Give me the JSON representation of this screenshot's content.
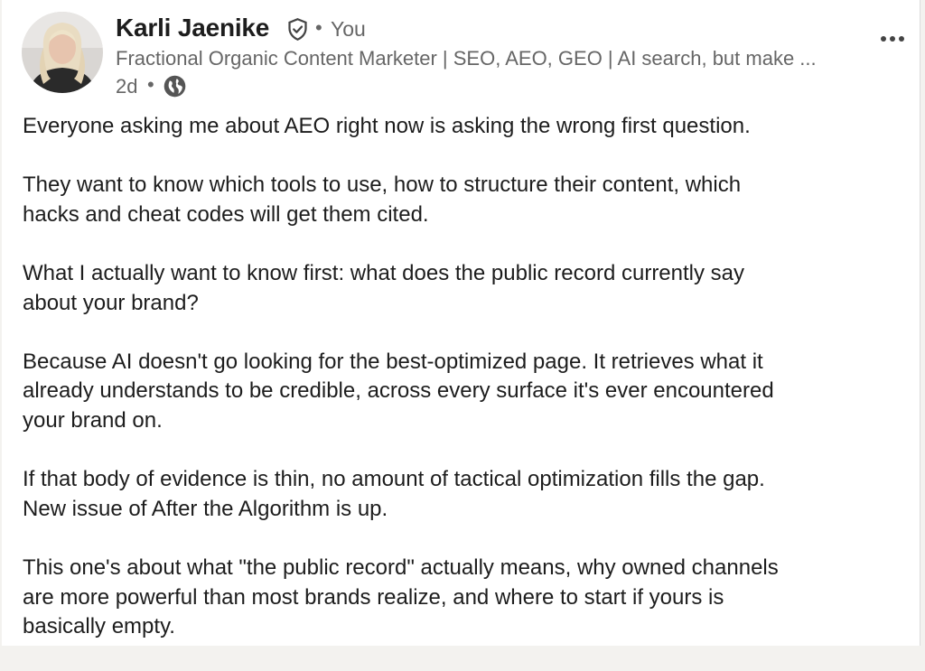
{
  "post": {
    "author": {
      "name": "Karli Jaenike",
      "connection": "You",
      "headline": "Fractional Organic Content Marketer | SEO, AEO, GEO | AI search, but make ...",
      "time": "2d",
      "visibility_icon": "globe-icon",
      "verified_icon": "verified-shield-icon"
    },
    "separator": "•",
    "paragraphs": [
      [
        "Everyone asking me about AEO right now is asking the wrong first question."
      ],
      [
        "They want to know which tools to use, how to structure their content, which",
        "hacks and cheat codes will get them cited."
      ],
      [
        "What I actually want to know first: what does the public record currently say",
        "about your brand?"
      ],
      [
        "Because AI doesn't go looking for the best-optimized page. It retrieves what it",
        "already understands to be credible, across every surface it's ever encountered",
        "your brand on."
      ],
      [
        "If that body of evidence is thin, no amount of tactical optimization fills the gap.",
        "New issue of After the Algorithm is up."
      ],
      [
        "This one's about what \"the public record\" actually means, why owned channels",
        "are more powerful than most brands realize, and where to start if yours is",
        "basically empty."
      ]
    ]
  },
  "colors": {
    "text": "#1d1d1d",
    "secondary": "#666666",
    "background": "#ffffff"
  }
}
